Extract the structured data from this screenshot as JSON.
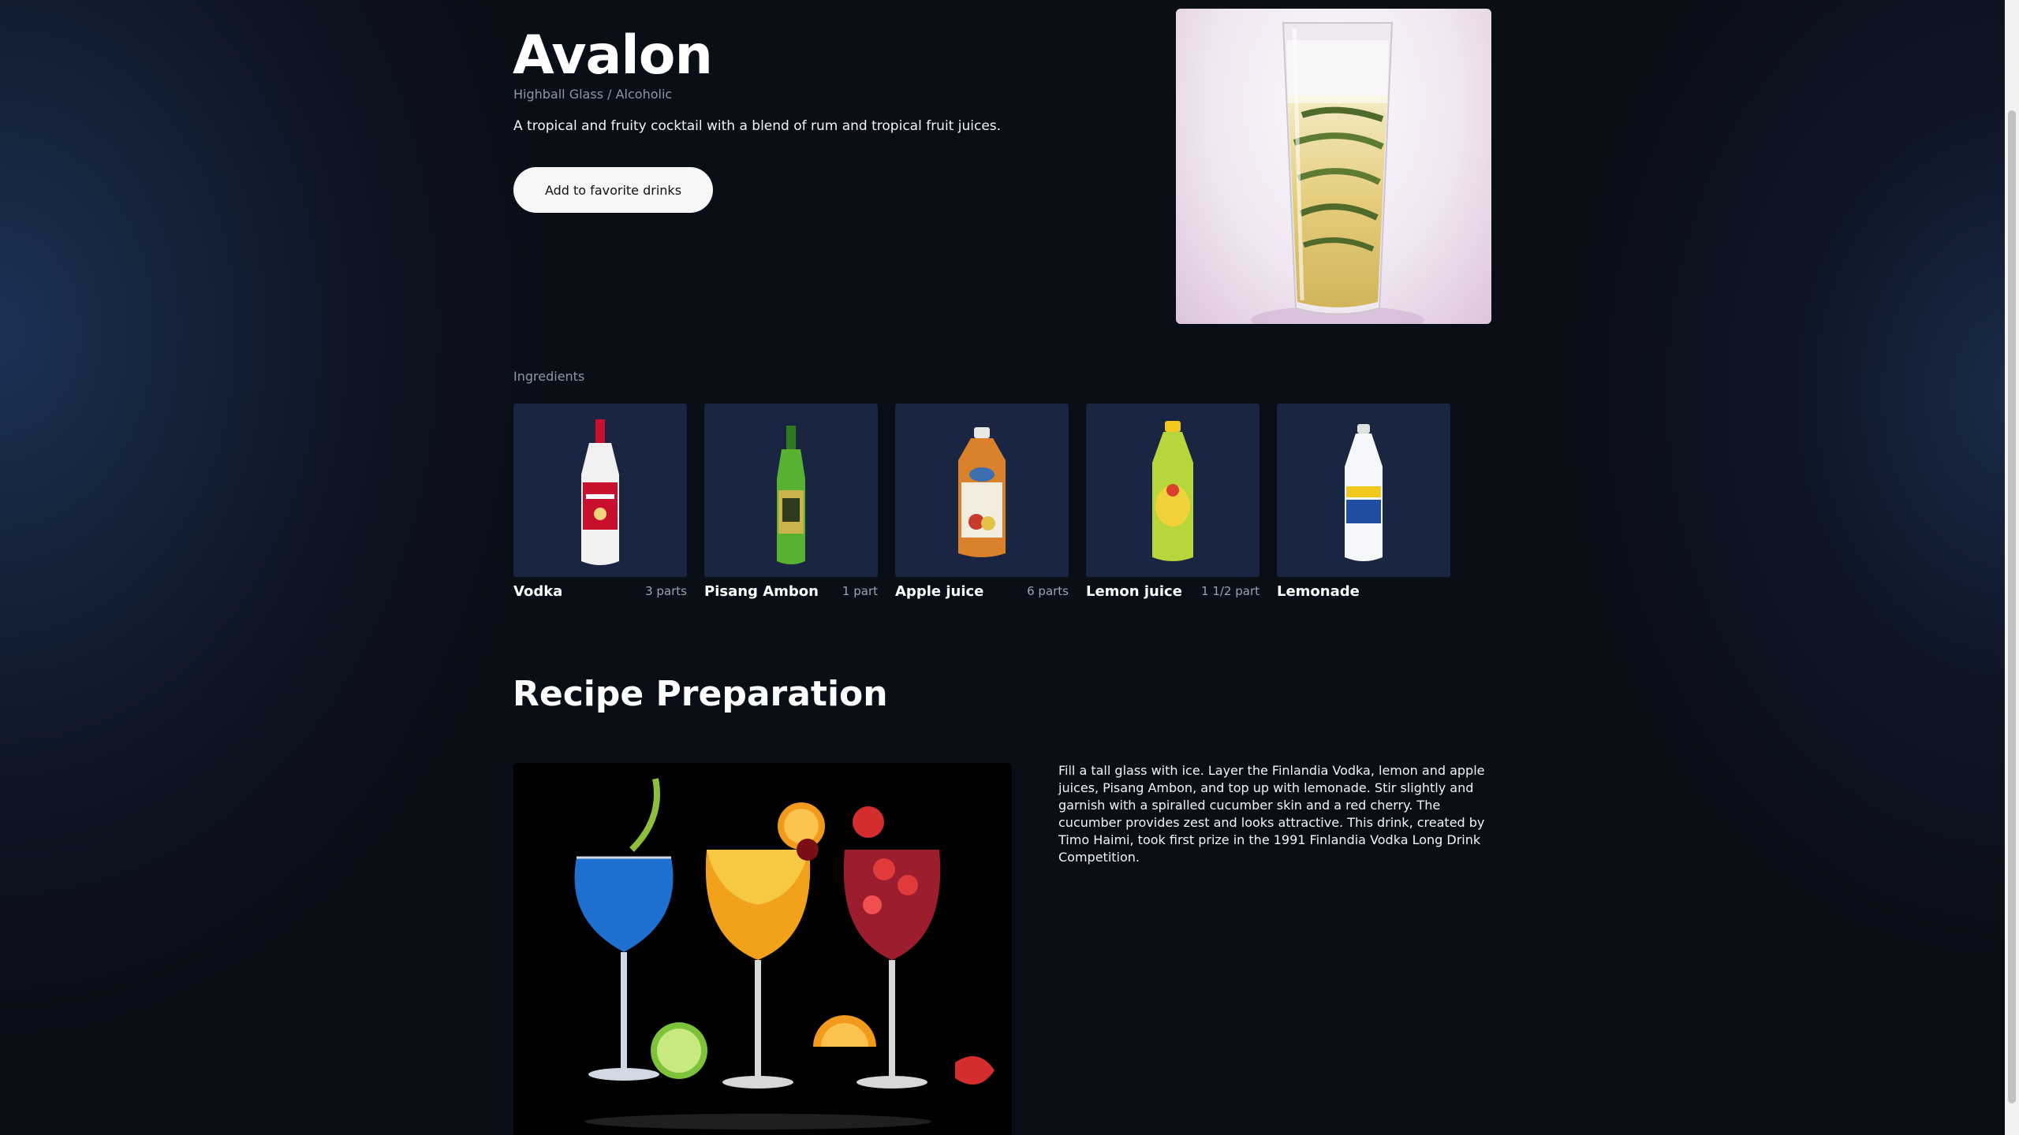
{
  "drink": {
    "title": "Avalon",
    "subtitle": "Highball Glass / Alcoholic",
    "description": "A tropical and fruity cocktail with a blend of rum and tropical fruit juices.",
    "favorite_button": "Add to favorite drinks"
  },
  "ingredients": {
    "label": "Ingredients",
    "items": [
      {
        "name": "Vodka",
        "qty": "3 parts"
      },
      {
        "name": "Pisang Ambon",
        "qty": "1 part"
      },
      {
        "name": "Apple juice",
        "qty": "6 parts"
      },
      {
        "name": "Lemon juice",
        "qty": "1 1/2 part"
      },
      {
        "name": "Lemonade",
        "qty": ""
      }
    ]
  },
  "recipe": {
    "heading": "Recipe Preparation",
    "instructions": "Fill a tall glass with ice. Layer the Finlandia Vodka, lemon and apple juices, Pisang Ambon, and top up with lemonade. Stir slightly and garnish with a spiralled cucumber skin and a red cherry. The cucumber provides zest and looks attractive. This drink, created by Timo Haimi, took first prize in the 1991 Finlandia Vodka Long Drink Competition."
  },
  "colors": {
    "background": "#0a0e17",
    "card": "#1a2542",
    "button_bg": "#f7f7f7",
    "muted_text": "#8d96a5"
  },
  "icons": {
    "vodka": "vodka-bottle-icon",
    "pisang_ambon": "liqueur-bottle-icon",
    "apple_juice": "juice-bottle-icon",
    "lemon_juice": "lemon-juice-bottle-icon",
    "lemonade": "lemonade-bottle-icon"
  }
}
